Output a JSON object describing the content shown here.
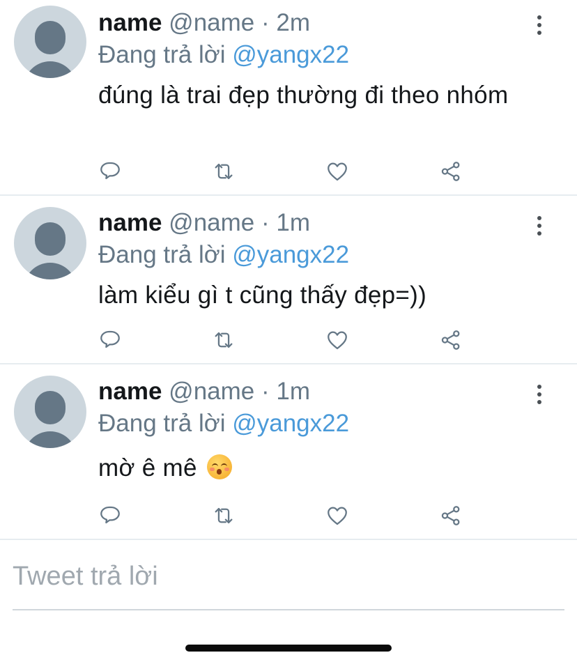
{
  "tweets": [
    {
      "username": "name",
      "handle": "@name",
      "separator": "·",
      "time": "2m",
      "reply_prefix": "Đang trả lời",
      "reply_to": "@yangx22",
      "text": "đúng là trai đẹp thường đi theo nhóm"
    },
    {
      "username": "name",
      "handle": "@name",
      "separator": "·",
      "time": "1m",
      "reply_prefix": "Đang trả lời",
      "reply_to": "@yangx22",
      "text": "làm kiểu gì t cũng thấy đẹp=))"
    },
    {
      "username": "name",
      "handle": "@name",
      "separator": "·",
      "time": "1m",
      "reply_prefix": "Đang trả lời",
      "reply_to": "@yangx22",
      "text": "mờ ê mê",
      "emoji": "kissing-closed-eyes-emoji"
    }
  ],
  "icons": {
    "reply": "reply-icon",
    "retweet": "retweet-icon",
    "like": "heart-icon",
    "share": "share-icon",
    "more": "more-vertical-icon"
  },
  "composer": {
    "placeholder": "Tweet trả lời"
  },
  "colors": {
    "mention": "#4a9ad9",
    "muted": "#657786",
    "avatar_bg": "#ccd6dd"
  }
}
